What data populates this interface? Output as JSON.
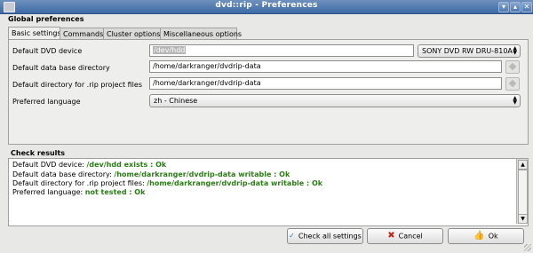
{
  "window": {
    "title": "dvd::rip - Preferences",
    "controls": [
      "▾",
      "▴",
      "✕"
    ]
  },
  "global_preferences": {
    "heading": "Global preferences"
  },
  "tabs": [
    {
      "label": "Basic settings",
      "active": true
    },
    {
      "label": "Commands",
      "active": false
    },
    {
      "label": "Cluster options",
      "active": false
    },
    {
      "label": "Miscellaneous options",
      "active": false
    }
  ],
  "settings": {
    "dvd_device": {
      "label": "Default DVD device",
      "value": "/dev/hdd",
      "combo": "SONY DVD RW DRU-810A"
    },
    "db_dir": {
      "label": "Default data base directory",
      "value": "/home/darkranger/dvdrip-data"
    },
    "project_dir": {
      "label": "Default directory for .rip project files",
      "value": "/home/darkranger/dvdrip-data"
    },
    "language": {
      "label": "Preferred language",
      "value": "zh - Chinese"
    }
  },
  "check_results": {
    "heading": "Check results",
    "lines": [
      {
        "label": "Default DVD device: ",
        "result": "/dev/hdd exists : Ok"
      },
      {
        "label": "Default data base directory: ",
        "result": "/home/darkranger/dvdrip-data writable : Ok"
      },
      {
        "label": "Default directory for .rip project files: ",
        "result": "/home/darkranger/dvdrip-data writable : Ok"
      },
      {
        "label": "Preferred language: ",
        "result": "not tested : Ok"
      }
    ]
  },
  "buttons": {
    "check_all": "Check all settings",
    "cancel": "Cancel",
    "ok": "Ok"
  },
  "colors": {
    "titlebar": "#3d6aa6",
    "ok_text": "#2a7d16",
    "cancel_icon": "#c0281c"
  },
  "icons": {
    "check": "spellcheck-icon",
    "cancel": "cancel-x-icon",
    "ok": "ok-thumb-icon"
  }
}
